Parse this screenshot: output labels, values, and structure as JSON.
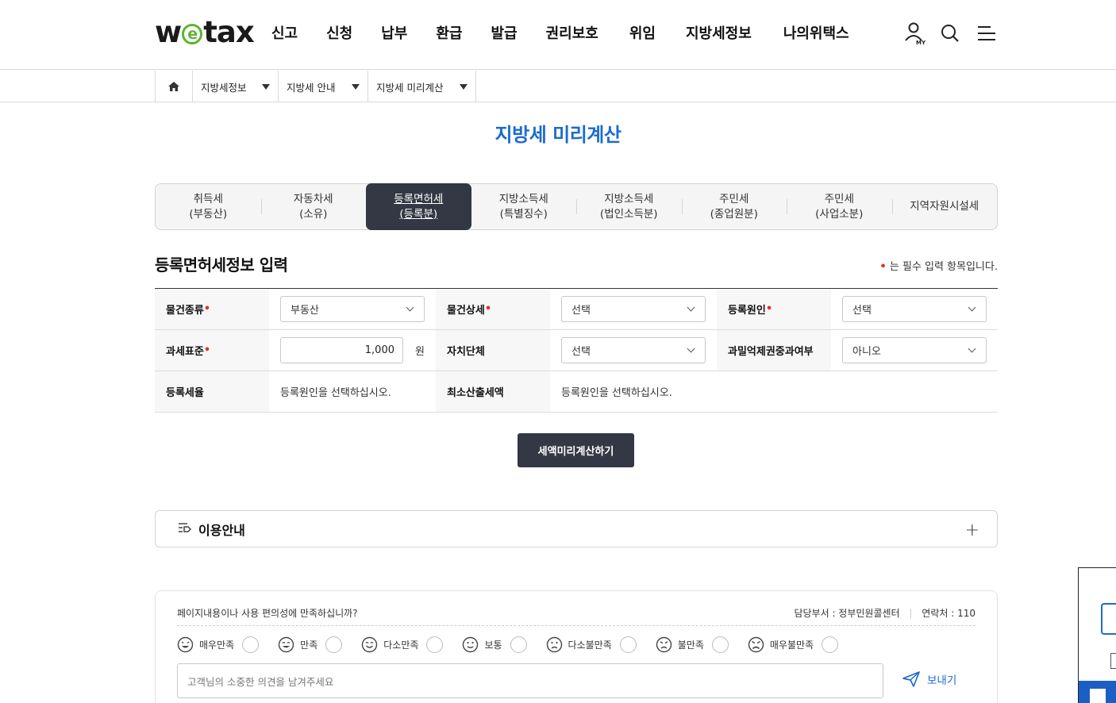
{
  "brand": {
    "logo_pre": "w",
    "logo_e": "e",
    "logo_post": "tax"
  },
  "gnb": [
    "신고",
    "신청",
    "납부",
    "환급",
    "발급",
    "권리보호",
    "위임",
    "지방세정보",
    "나의위택스"
  ],
  "icons": {
    "my": "user-my-icon",
    "search": "search-icon",
    "menu": "hamburger-menu-icon",
    "home": "home-icon"
  },
  "breadcrumb": [
    "지방세정보",
    "지방세 안내",
    "지방세 미리계산"
  ],
  "page_title": "지방세 미리계산",
  "tabs": [
    "취득세\n(부동산)",
    "자동차세\n(소유)",
    "등록면허세\n(등록분)",
    "지방소득세\n(특별징수)",
    "지방소득세\n(법인소득분)",
    "주민세\n(종업원분)",
    "주민세\n(사업소분)",
    "지역자원시설세"
  ],
  "active_tab_index": 2,
  "section": {
    "title": "등록면허세정보 입력",
    "required_note": "는 필수 입력 항목입니다.",
    "required_mark": "•"
  },
  "form": {
    "object_type_label": "물건종류",
    "object_type_value": "부동산",
    "object_detail_label": "물건상세",
    "object_detail_value": "선택",
    "reg_cause_label": "등록원인",
    "reg_cause_value": "선택",
    "tax_base_label": "과세표준",
    "tax_base_value": "1,000",
    "tax_base_unit": "원",
    "local_gov_label": "자치단체",
    "local_gov_value": "선택",
    "dense_label": "과밀억제권중과여부",
    "dense_value": "아니오",
    "rate_label": "등록세율",
    "rate_value": "등록원인을 선택하십시오.",
    "min_tax_label": "최소산출세액",
    "min_tax_value": "등록원인을 선택하십시오."
  },
  "calc_button": "세액미리계산하기",
  "guide": {
    "title": "이용안내",
    "toggle": "+"
  },
  "feedback": {
    "question": "페이지내용이나 사용 편의성에 만족하십니까?",
    "dept": "담당부서 : 정부민원콜센터",
    "contact": "연락처 : 110",
    "ratings": [
      "매우만족",
      "만족",
      "다소만족",
      "보통",
      "다소불만족",
      "불만족",
      "매우불만족"
    ],
    "placeholder": "고객님의 소중한 의견을 남겨주세요",
    "send": "보내기"
  },
  "colors": {
    "accent": "#1c6bd0",
    "dark": "#343844",
    "logo_green": "#5cb531",
    "required": "#e0321e"
  }
}
